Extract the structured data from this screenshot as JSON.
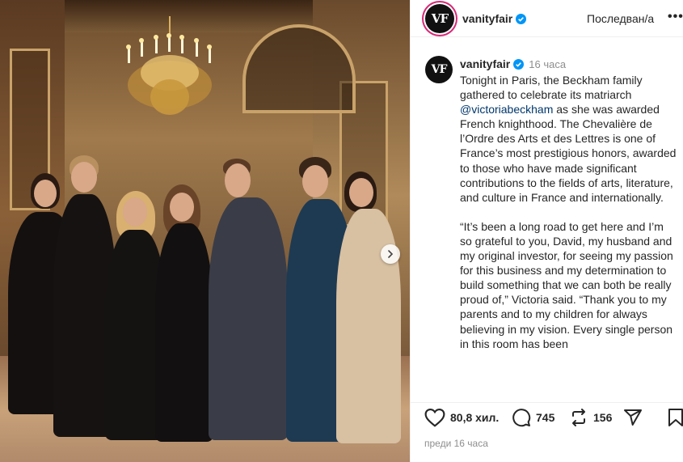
{
  "header": {
    "username": "vanityfair",
    "avatar_text": "VF",
    "follow_label": "Последван/а",
    "more_label": "•••"
  },
  "caption": {
    "username": "vanityfair",
    "avatar_text": "VF",
    "time": "16 часа",
    "text_before_mention": "Tonight in Paris, the Beckham family gathered to celebrate its matriarch ",
    "mention": "@victoriabeckham",
    "text_after_mention": " as she was awarded French knighthood. The Chevalière de l’Ordre des Arts et des Lettres is one of France’s most prestigious honors, awarded to those who have made significant contributions to the fields of arts, literature, and culture in France and internationally.",
    "paragraph2": "“It’s been a long road to get here and I’m so grateful to you, David, my husband and my original investor, for seeing my passion for this business and my determination to build something that we can both be really proud of,” Victoria said. “Thank you to my parents and to my children for always believing in my vision. Every single person in this room has been"
  },
  "actions": {
    "likes": "80,8 хил.",
    "comments": "745",
    "reposts": "156"
  },
  "timestamp": "преди 16 часа",
  "icons": {
    "like": "heart-icon",
    "comment": "comment-icon",
    "repost": "repost-icon",
    "share": "share-icon",
    "save": "bookmark-icon",
    "next": "chevron-right-icon",
    "verified": "verified-badge-icon"
  },
  "colors": {
    "verified": "#0095f6",
    "mention": "#00376b",
    "muted": "#8e8e8e"
  }
}
